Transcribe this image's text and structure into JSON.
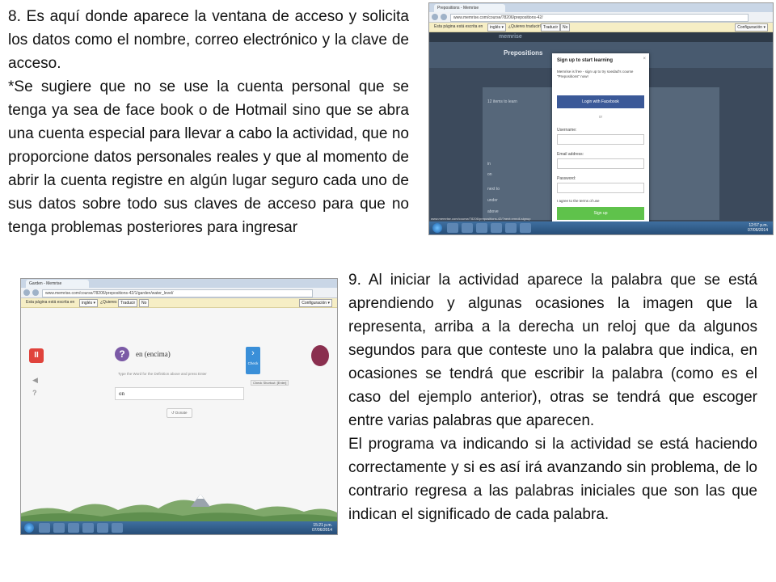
{
  "step8": {
    "paragraphs": [
      "8. Es aquí donde aparece la ventana de acceso y solicita los datos como el nombre, correo electrónico y la clave de acceso.",
      "*Se sugiere que no se use la cuenta personal que se tenga ya sea de face book o de Hotmail sino que se abra una cuenta especial para llevar a cabo la actividad, que no proporcione datos personales reales y que al momento de abrir la cuenta registre en algún lugar seguro cada uno de sus datos sobre todo sus claves de acceso para que no tenga problemas posteriores para ingresar"
    ]
  },
  "step9": {
    "paragraphs": [
      "9. Al iniciar la actividad aparece la palabra que se está aprendiendo y algunas ocasiones la imagen que la representa, arriba a la derecha un reloj que da algunos segundos para que conteste uno la palabra que indica, en ocasiones se tendrá que escribir la palabra (como es el caso del ejemplo anterior), otras se tendrá que escoger entre varias palabras que aparecen.",
      "El programa va indicando si la actividad se está haciendo correctamente y si es así irá avanzando sin problema, de lo contrario regresa a las palabras iniciales que son las que indican el significado de cada palabra."
    ]
  },
  "screenshot1": {
    "tab": "Prepositions - Memrise",
    "url": "www.memrise.com/course/78206/prepositions-42/",
    "translate_bar": {
      "text": "Esta página está escrita en",
      "lang": "inglés ▾",
      "question": "¿Quieres traducirla?",
      "translate": "Traducir",
      "no": "No",
      "config": "Configuración ▾"
    },
    "site_logo": "memrise",
    "course_title": "Prepositions",
    "list_header": "12 items to learn",
    "rows": [
      "in",
      "on",
      "next to",
      "under",
      "above"
    ],
    "modal": {
      "title": "Sign up to start learning",
      "close": "×",
      "subtitle": "Memrise is free - sign up to try soedad's course \"Prepositions\" now!",
      "facebook": "Login with Facebook",
      "or": "or",
      "username": "Username:",
      "email": "Email address:",
      "password": "Password:",
      "agree": "I agree to the terms of use",
      "signup": "Sign up"
    },
    "status_url": "www.memrise.com/course/78206/prepositions-42/?next=enroll-signup",
    "clock_time": "12:57 p.m.",
    "clock_date": "07/06/2014"
  },
  "screenshot2": {
    "tab": "Garden - Memrise",
    "url": "www.memrise.com/course/78206/prepositions-42/1/garden/water_level/",
    "translate_bar": {
      "text": "Esta página está escrita en",
      "lang": "inglés ▾",
      "question": "¿Quieres traducirla?",
      "translate": "Traducir",
      "no": "No",
      "config": "Configuración ▾"
    },
    "pause": "II",
    "word": "en (encima)",
    "instruction": "Type the Word for the Definition above and press Enter",
    "answer": "on",
    "check": "Check",
    "check_arrow": "›",
    "shortcut": "Check Shortcut: [Enter]",
    "skip": "↺ Donate",
    "clock_time": "15:21 p.m.",
    "clock_date": "07/06/2014"
  }
}
